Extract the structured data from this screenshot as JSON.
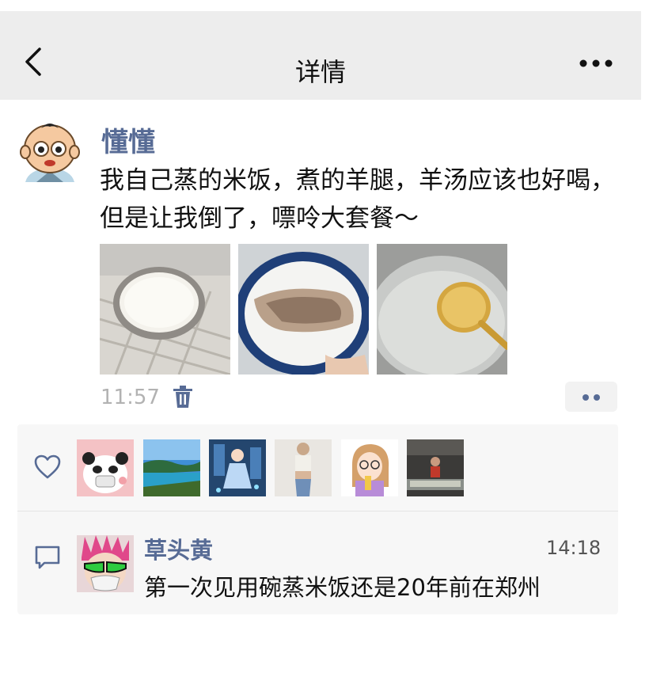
{
  "nav": {
    "title": "详情",
    "back_icon": "chevron-left-icon",
    "more_icon": "more-horizontal-icon"
  },
  "post": {
    "author": "懂懂",
    "text": "我自己蒸的米饭，煮的羊腿，羊汤应该也好喝，但是让我倒了，嘌呤大套餐～",
    "photos": [
      "rice-photo",
      "lamb-leg-photo",
      "soup-ladle-photo"
    ],
    "time": "11:57",
    "delete_icon": "trash-icon",
    "action_icon": "two-dots-icon"
  },
  "likes": {
    "icon": "heart-icon",
    "avatars": [
      "panda-mask-avatar",
      "lake-landscape-avatar",
      "anime-girl-avatar",
      "woman-photo-avatar",
      "cartoon-girl-avatar",
      "shop-woman-avatar"
    ]
  },
  "comments": [
    {
      "icon": "comment-icon",
      "avatar": "green-glasses-avatar",
      "name": "草头黄",
      "time": "14:18",
      "text": "第一次见用碗蒸米饭还是20年前在郑州"
    }
  ],
  "colors": {
    "link_blue": "#576b95",
    "nav_bg": "#ededed",
    "panel_bg": "#f7f7f7",
    "time_gray": "#b2b2b2"
  }
}
